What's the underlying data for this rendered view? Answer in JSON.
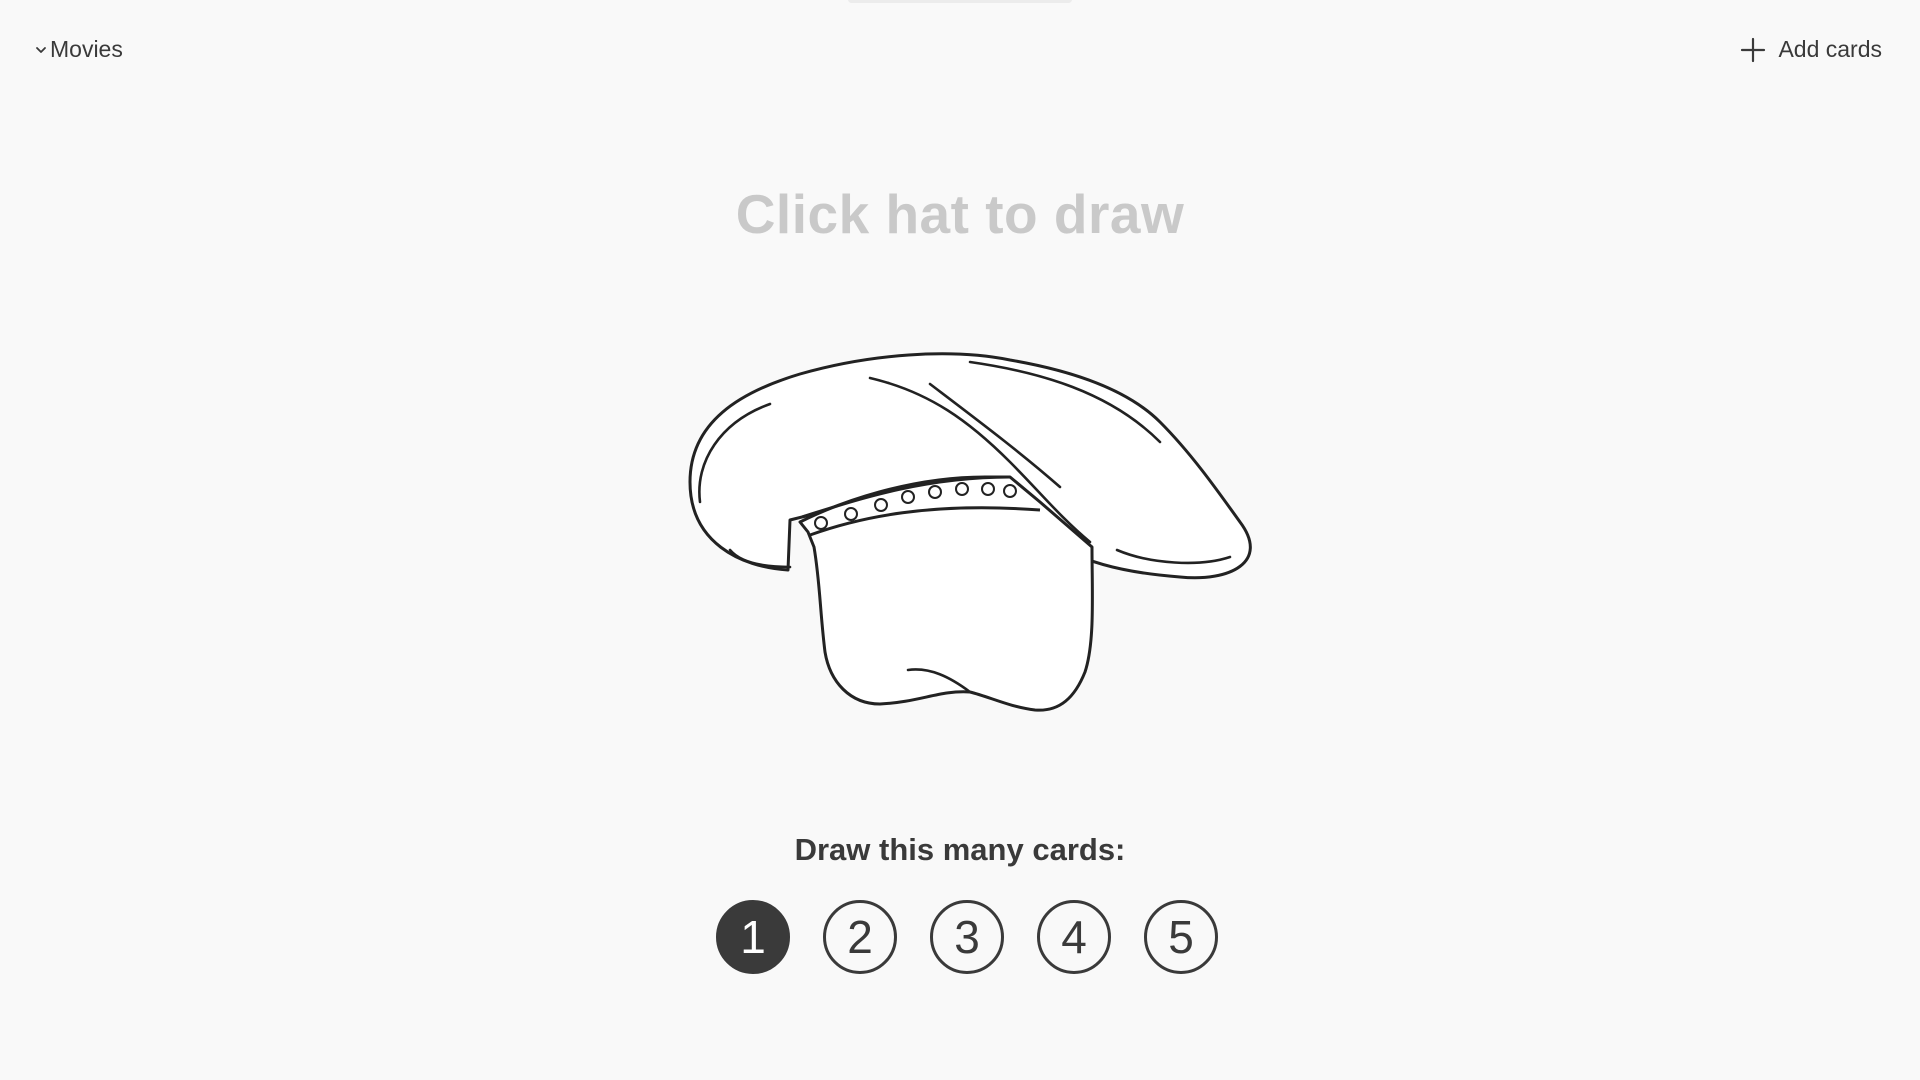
{
  "header": {
    "deck_name": "Movies",
    "add_cards_label": "Add cards"
  },
  "main": {
    "headline": "Click hat to draw",
    "hat_icon": "hat-icon",
    "count_label": "Draw this many cards:",
    "count_options": [
      "1",
      "2",
      "3",
      "4",
      "5"
    ],
    "selected_count": "1"
  },
  "colors": {
    "background": "#f9f9f9",
    "text": "#3a3a3a",
    "headline": "#c9c9c9",
    "selected_fill": "#3a3a3a"
  }
}
